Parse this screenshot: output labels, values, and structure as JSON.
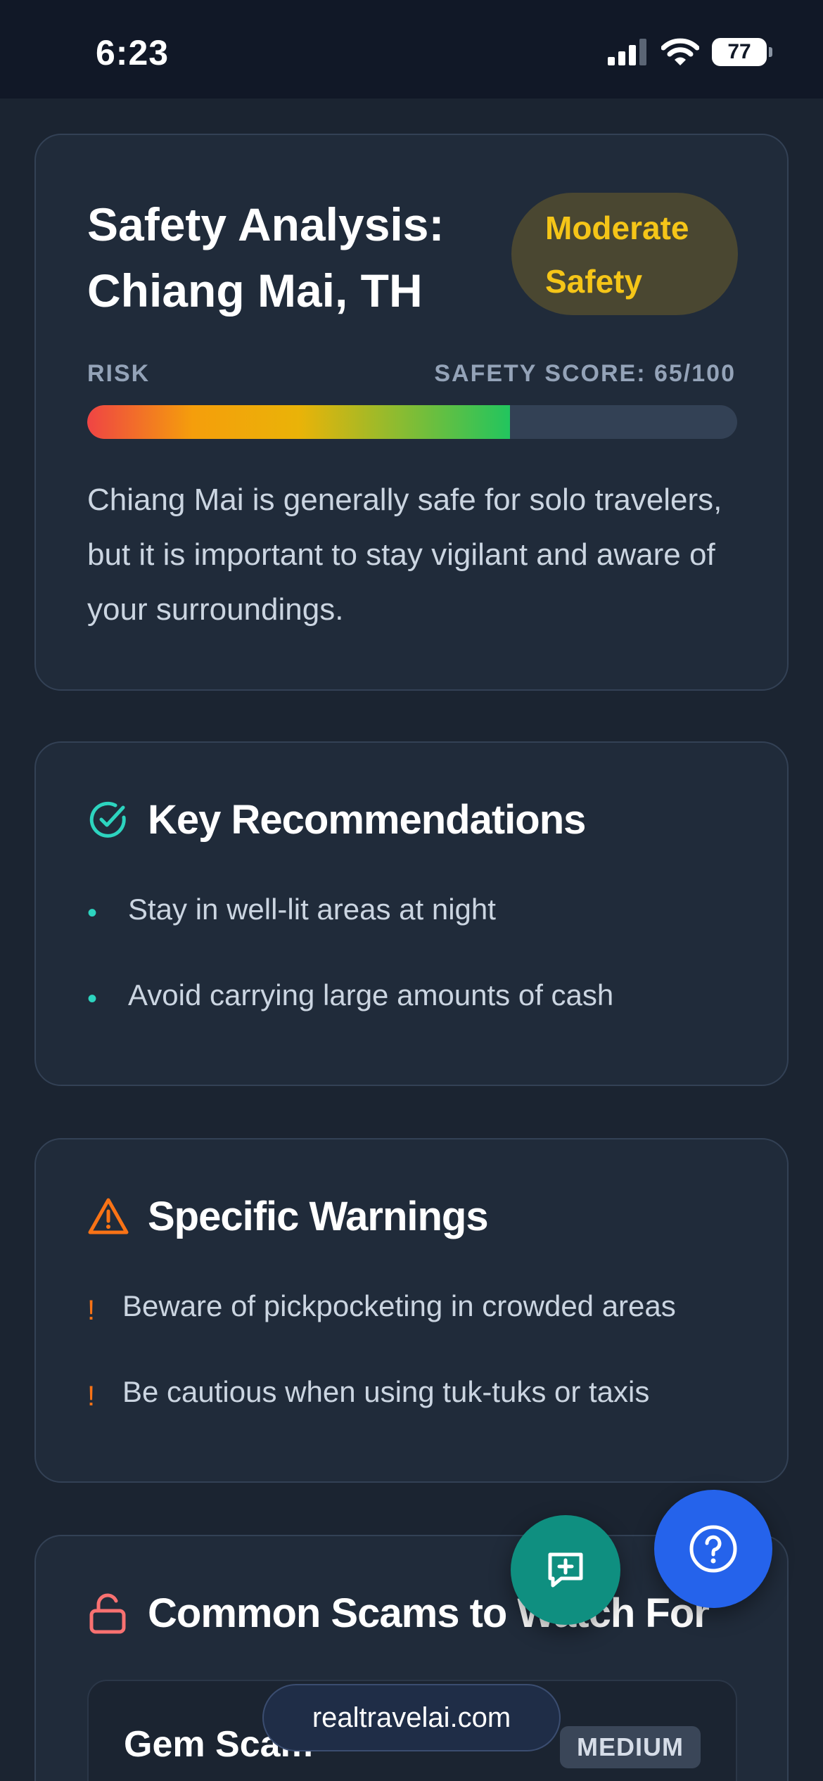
{
  "status_bar": {
    "time": "6:23",
    "battery": "77"
  },
  "safety": {
    "title": "Safety Analysis: Chiang Mai, TH",
    "badge": "Moderate Safety",
    "risk_label": "RISK",
    "score_label": "SAFETY SCORE: 65/100",
    "score_fraction": 0.65,
    "description": "Chiang Mai is generally safe for solo travelers, but it is important to stay vigilant and aware of your surroundings."
  },
  "recommendations": {
    "title": "Key Recommendations",
    "icon": "check-circle-icon",
    "bullet": "•",
    "items": [
      "Stay in well-lit areas at night",
      "Avoid carrying large amounts of cash"
    ]
  },
  "warnings": {
    "title": "Specific Warnings",
    "icon": "warning-triangle-icon",
    "bullet": "!",
    "items": [
      "Beware of pickpocketing in crowded areas",
      "Be cautious when using tuk-tuks or taxis"
    ]
  },
  "scams": {
    "title": "Common Scams to Watch For",
    "icon": "unlock-icon",
    "items": [
      {
        "name": "Gem Scam",
        "level": "MEDIUM"
      }
    ]
  },
  "browser": {
    "url": "realtravelai.com"
  },
  "colors": {
    "accent_teal": "#2dd4bf",
    "warning_orange": "#f97316",
    "badge_yellow": "#f5c518",
    "lock_red": "#f87171",
    "help_blue": "#2563eb",
    "chat_teal": "#0f8f80"
  }
}
